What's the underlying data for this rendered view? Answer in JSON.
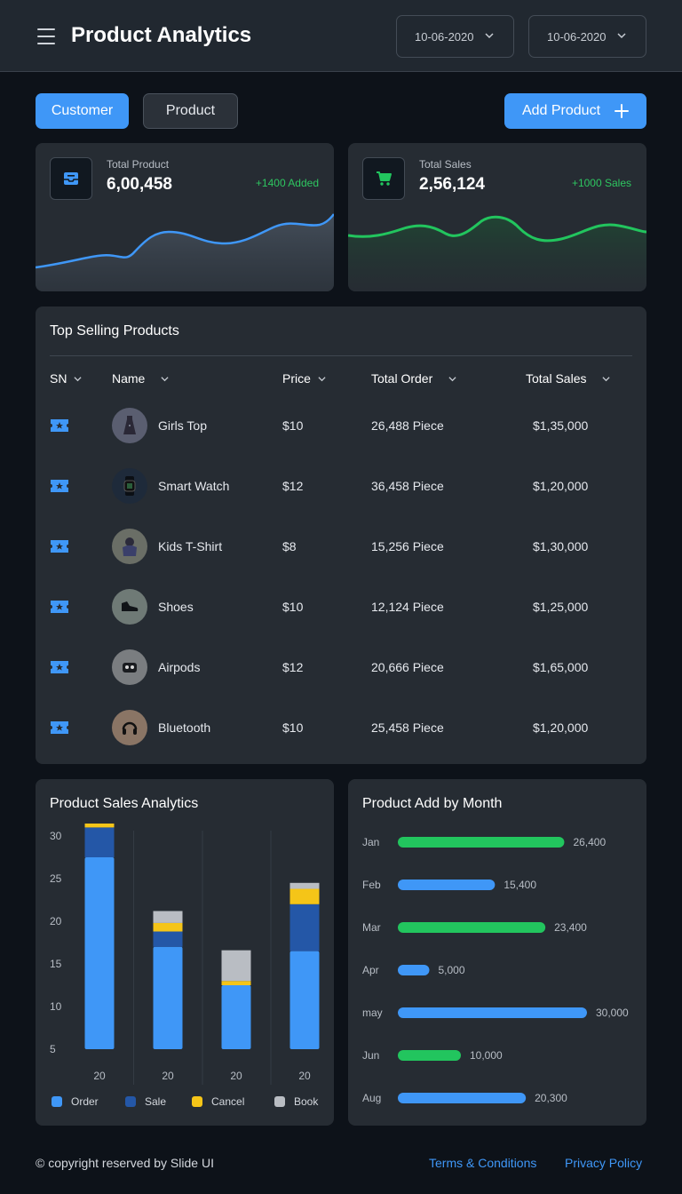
{
  "header": {
    "title": "Product Analytics",
    "date_from": "10-06-2020",
    "date_to": "10-06-2020"
  },
  "actions": {
    "customer": "Customer",
    "product": "Product",
    "add_product": "Add Product"
  },
  "stats": {
    "total_product": {
      "label": "Total Product",
      "value": "6,00,458",
      "delta": "+1400 Added"
    },
    "total_sales": {
      "label": "Total Sales",
      "value": "2,56,124",
      "delta": "+1000 Sales"
    }
  },
  "top_selling": {
    "title": "Top Selling Products",
    "columns": [
      "SN",
      "Name",
      "Price",
      "Total Order",
      "Total Sales"
    ],
    "rows": [
      {
        "name": "Girls Top",
        "price": "$10",
        "orders": "26,488 Piece",
        "sales": "$1,35,000"
      },
      {
        "name": "Smart Watch",
        "price": "$12",
        "orders": "36,458 Piece",
        "sales": "$1,20,000"
      },
      {
        "name": "Kids T-Shirt",
        "price": "$8",
        "orders": "15,256 Piece",
        "sales": "$1,30,000"
      },
      {
        "name": "Shoes",
        "price": "$10",
        "orders": "12,124 Piece",
        "sales": "$1,25,000"
      },
      {
        "name": "Airpods",
        "price": "$12",
        "orders": "20,666 Piece",
        "sales": "$1,65,000"
      },
      {
        "name": "Bluetooth",
        "price": "$10",
        "orders": "25,458 Piece",
        "sales": "$1,20,000"
      }
    ]
  },
  "chart_data": [
    {
      "type": "bar",
      "title": "Product Sales Analytics",
      "stacked": true,
      "categories": [
        "20",
        "20",
        "20",
        "20"
      ],
      "yticks": [
        "30",
        "25",
        "20",
        "15",
        "10",
        "5"
      ],
      "ylim": [
        5,
        30
      ],
      "series": [
        {
          "name": "Order",
          "color": "#3f97f7",
          "values": [
            22.5,
            12,
            7.5,
            11.5
          ]
        },
        {
          "name": "Sale",
          "color": "#2457a7",
          "values": [
            3.5,
            1.8,
            0,
            5.5
          ]
        },
        {
          "name": "Cancel",
          "color": "#f5c518",
          "values": [
            2,
            1,
            0.5,
            1.8
          ]
        },
        {
          "name": "Book",
          "color": "#b9bdc3",
          "values": [
            0.8,
            1.4,
            3.6,
            0.7
          ]
        }
      ]
    },
    {
      "type": "bar",
      "orientation": "horizontal",
      "title": "Product Add  by Month",
      "categories": [
        "Jan",
        "Feb",
        "Mar",
        "Apr",
        "may",
        "Jun",
        "Aug"
      ],
      "values": [
        26400,
        15400,
        23400,
        5000,
        30000,
        10000,
        20300
      ],
      "value_labels": [
        "26,400",
        "15,400",
        "23,400",
        "5,000",
        "30,000",
        "10,000",
        "20,300"
      ],
      "colors": [
        "#22c55e",
        "#3f97f7",
        "#22c55e",
        "#3f97f7",
        "#3f97f7",
        "#22c55e",
        "#3f97f7"
      ],
      "xlim": [
        0,
        30000
      ]
    }
  ],
  "footer": {
    "copyright": "© copyright reserved by Slide UI",
    "terms": "Terms & Conditions",
    "privacy": "Privacy Policy"
  },
  "colors": {
    "accent": "#3f97f7",
    "positive": "#2ec660",
    "card": "#262c33",
    "background": "#0d1219"
  }
}
